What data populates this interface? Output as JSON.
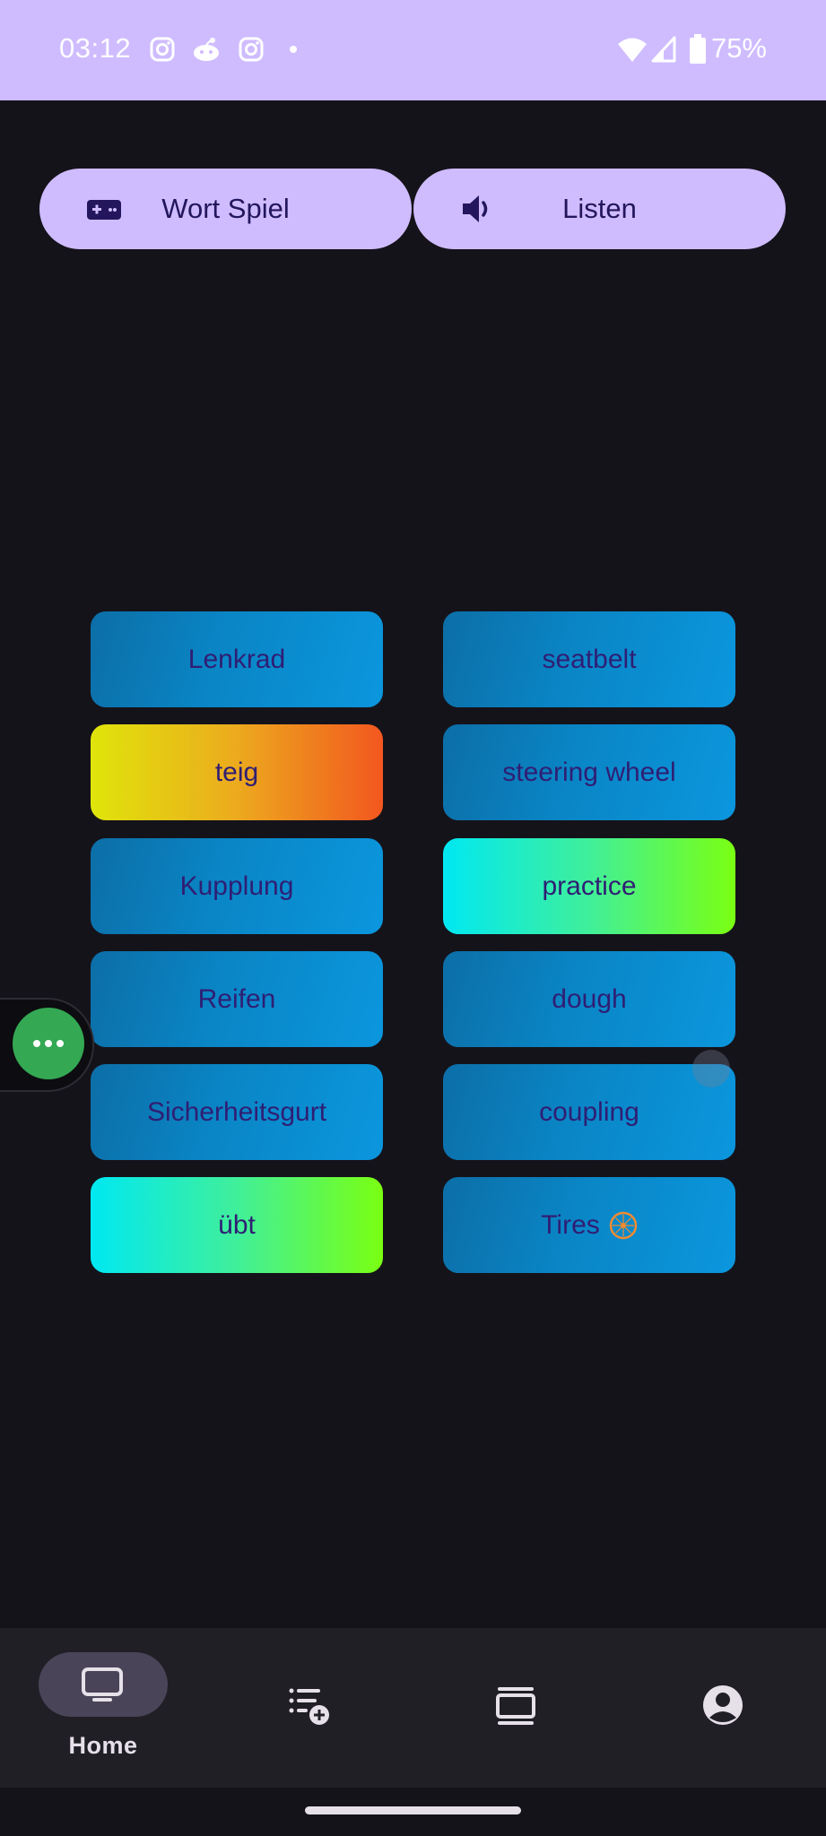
{
  "status_bar": {
    "time": "03:12",
    "notification_icons": [
      "instagram-icon",
      "reddit-icon",
      "instagram-icon",
      "dot-icon"
    ],
    "battery": "75%"
  },
  "top_buttons": {
    "word_game": "Wort Spiel",
    "listen": "Listen"
  },
  "tiles": {
    "left": [
      {
        "label": "Lenkrad",
        "style": "blue"
      },
      {
        "label": "teig",
        "style": "orange"
      },
      {
        "label": "Kupplung",
        "style": "blue"
      },
      {
        "label": "Reifen",
        "style": "blue"
      },
      {
        "label": "Sicherheitsgurt",
        "style": "blue"
      },
      {
        "label": "übt",
        "style": "green"
      }
    ],
    "right": [
      {
        "label": "seatbelt",
        "style": "blue"
      },
      {
        "label": "steering wheel",
        "style": "blue"
      },
      {
        "label": "practice",
        "style": "green"
      },
      {
        "label": "dough",
        "style": "blue"
      },
      {
        "label": "coupling",
        "style": "blue"
      },
      {
        "label": "Tires",
        "style": "blue",
        "icon": "wheel-icon"
      }
    ]
  },
  "bottom_nav": {
    "home": "Home",
    "items": [
      "tv-icon",
      "playlist-add-icon",
      "card-stack-icon",
      "account-icon"
    ]
  },
  "colors": {
    "accent": "#cfbcff",
    "background": "#15131a",
    "nav_background": "#211f26",
    "tile_text": "#2f1e73",
    "float_button": "#34a853"
  }
}
